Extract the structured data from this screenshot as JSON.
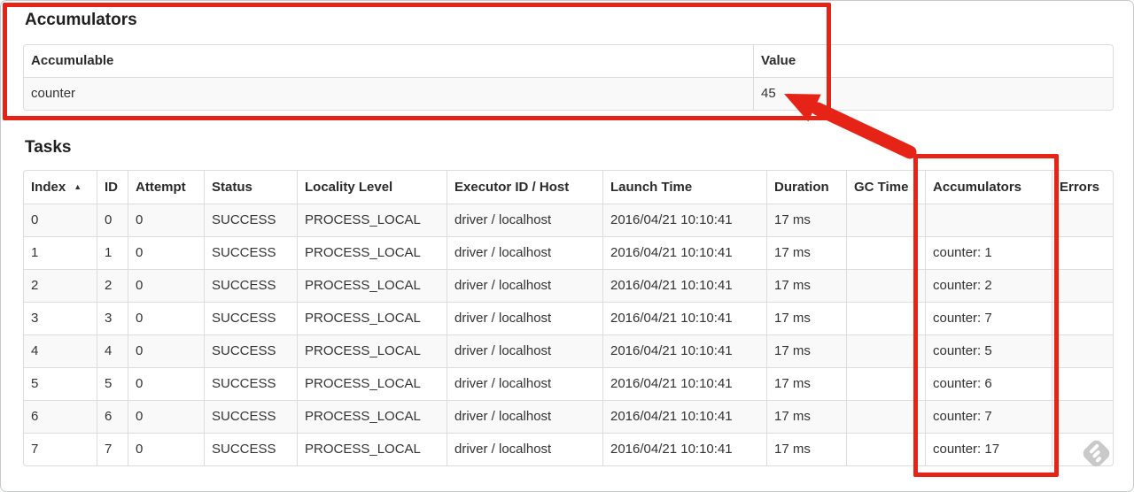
{
  "accumulators_section": {
    "heading": "Accumulators",
    "headers": [
      "Accumulable",
      "Value"
    ],
    "rows": [
      {
        "accumulable": "counter",
        "value": "45"
      }
    ]
  },
  "tasks_section": {
    "heading": "Tasks",
    "headers": [
      "Index",
      "ID",
      "Attempt",
      "Status",
      "Locality Level",
      "Executor ID / Host",
      "Launch Time",
      "Duration",
      "GC Time",
      "Accumulators",
      "Errors"
    ],
    "sort_indicator": "▲",
    "rows": [
      {
        "index": "0",
        "id": "0",
        "attempt": "0",
        "status": "SUCCESS",
        "locality_level": "PROCESS_LOCAL",
        "executor_id_host": "driver / localhost",
        "launch_time": "2016/04/21 10:10:41",
        "duration": "17 ms",
        "gc_time": "",
        "accumulators": "",
        "errors": ""
      },
      {
        "index": "1",
        "id": "1",
        "attempt": "0",
        "status": "SUCCESS",
        "locality_level": "PROCESS_LOCAL",
        "executor_id_host": "driver / localhost",
        "launch_time": "2016/04/21 10:10:41",
        "duration": "17 ms",
        "gc_time": "",
        "accumulators": "counter: 1",
        "errors": ""
      },
      {
        "index": "2",
        "id": "2",
        "attempt": "0",
        "status": "SUCCESS",
        "locality_level": "PROCESS_LOCAL",
        "executor_id_host": "driver / localhost",
        "launch_time": "2016/04/21 10:10:41",
        "duration": "17 ms",
        "gc_time": "",
        "accumulators": "counter: 2",
        "errors": ""
      },
      {
        "index": "3",
        "id": "3",
        "attempt": "0",
        "status": "SUCCESS",
        "locality_level": "PROCESS_LOCAL",
        "executor_id_host": "driver / localhost",
        "launch_time": "2016/04/21 10:10:41",
        "duration": "17 ms",
        "gc_time": "",
        "accumulators": "counter: 7",
        "errors": ""
      },
      {
        "index": "4",
        "id": "4",
        "attempt": "0",
        "status": "SUCCESS",
        "locality_level": "PROCESS_LOCAL",
        "executor_id_host": "driver / localhost",
        "launch_time": "2016/04/21 10:10:41",
        "duration": "17 ms",
        "gc_time": "",
        "accumulators": "counter: 5",
        "errors": ""
      },
      {
        "index": "5",
        "id": "5",
        "attempt": "0",
        "status": "SUCCESS",
        "locality_level": "PROCESS_LOCAL",
        "executor_id_host": "driver / localhost",
        "launch_time": "2016/04/21 10:10:41",
        "duration": "17 ms",
        "gc_time": "",
        "accumulators": "counter: 6",
        "errors": ""
      },
      {
        "index": "6",
        "id": "6",
        "attempt": "0",
        "status": "SUCCESS",
        "locality_level": "PROCESS_LOCAL",
        "executor_id_host": "driver / localhost",
        "launch_time": "2016/04/21 10:10:41",
        "duration": "17 ms",
        "gc_time": "",
        "accumulators": "counter: 7",
        "errors": ""
      },
      {
        "index": "7",
        "id": "7",
        "attempt": "0",
        "status": "SUCCESS",
        "locality_level": "PROCESS_LOCAL",
        "executor_id_host": "driver / localhost",
        "launch_time": "2016/04/21 10:10:41",
        "duration": "17 ms",
        "gc_time": "",
        "accumulators": "counter: 17",
        "errors": ""
      }
    ]
  },
  "annotations": {
    "accent_color": "#e52417"
  }
}
